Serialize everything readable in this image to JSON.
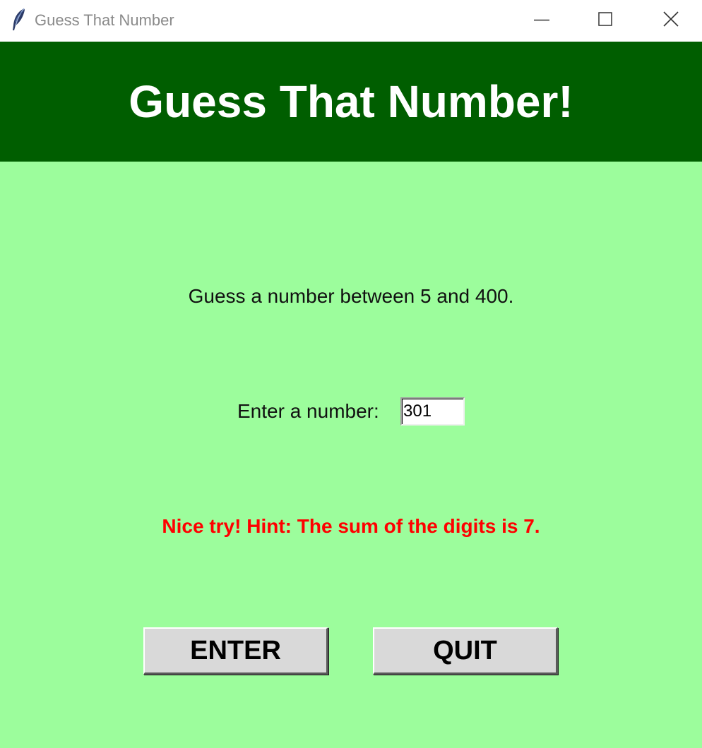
{
  "window": {
    "title": "Guess That Number",
    "icon": "feather-icon",
    "controls": [
      "minimize-icon",
      "maximize-icon",
      "close-icon"
    ]
  },
  "header": {
    "title": "Guess That Number!",
    "background": "#005e00"
  },
  "main": {
    "instructions": "Guess a number between 5 and 400.",
    "entry_label": "Enter a number:",
    "entry_value": "301",
    "hint": "Nice try!  Hint: The sum of the digits is 7.",
    "hint_color": "#ff0000",
    "background": "#9cfd9c"
  },
  "buttons": {
    "enter_label": "ENTER",
    "quit_label": "QUIT"
  }
}
